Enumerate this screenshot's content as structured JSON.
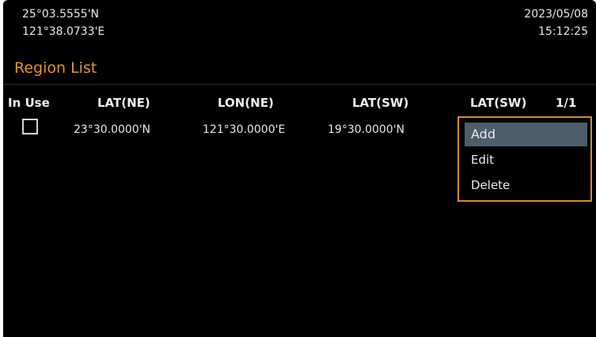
{
  "header": {
    "latitude": "25°03.5555'N",
    "longitude": "121°38.0733'E",
    "date": "2023/05/08",
    "time": "15:12:25"
  },
  "title": "Region List",
  "columns": {
    "in_use": "In Use",
    "lat_ne": "LAT(NE)",
    "lon_ne": "LON(NE)",
    "lat_sw": "LAT(SW)",
    "lon_sw": "LAT(SW)",
    "page": "1/1"
  },
  "rows": [
    {
      "in_use": false,
      "lat_ne": "23°30.0000'N",
      "lon_ne": "121°30.0000'E",
      "lat_sw": "19°30.0000'N"
    }
  ],
  "context_menu": {
    "items": [
      {
        "label": "Add",
        "selected": true
      },
      {
        "label": "Edit",
        "selected": false
      },
      {
        "label": "Delete",
        "selected": false
      }
    ]
  },
  "colors": {
    "background": "#000000",
    "title": "#e8942a",
    "menu_border": "#d78c2a",
    "menu_selected": "#4a5f6a",
    "text": "#e8e8e8"
  }
}
